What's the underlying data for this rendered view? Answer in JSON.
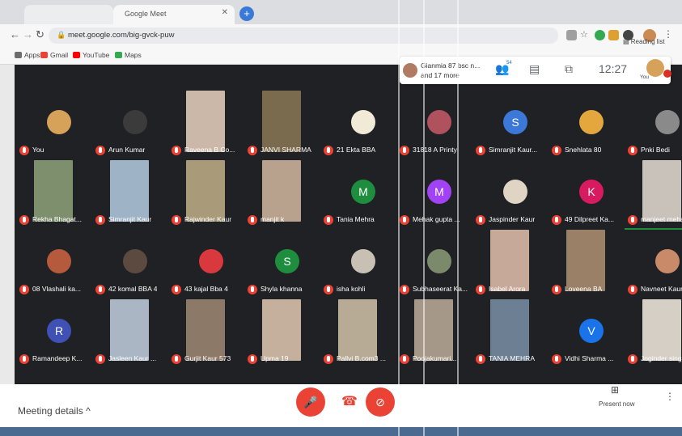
{
  "browser": {
    "tab_title": "Google Meet",
    "url": "meet.google.com/big-gvck-puw",
    "reading_list_label": "Reading list",
    "bookmarks": [
      {
        "label": "Apps",
        "icon": "apps-grid-icon",
        "color": "#6c6c6c"
      },
      {
        "label": "Gmail",
        "icon": "gmail-icon",
        "color": "#ea4335"
      },
      {
        "label": "YouTube",
        "icon": "youtube-icon",
        "color": "#ff0000"
      },
      {
        "label": "Maps",
        "icon": "maps-icon",
        "color": "#34a853"
      }
    ]
  },
  "meet": {
    "pinned": {
      "line1": "Gianmia 87 bsc n...",
      "line2": "and 17 more"
    },
    "participants_count": "54",
    "time": "12:27",
    "self_label": "You",
    "meeting_details_label": "Meeting details",
    "present_now_label": "Present now",
    "participants": [
      {
        "name": "You",
        "kind": "photo",
        "color": "#d6a25a"
      },
      {
        "name": "Arun Kumar",
        "kind": "photo",
        "color": "#3b3b3b"
      },
      {
        "name": "Raveena B Co...",
        "kind": "video",
        "color": "#cbb8a8"
      },
      {
        "name": "JANVI SHARMA",
        "kind": "video",
        "color": "#7a6a4e"
      },
      {
        "name": "21 Ekta BBA",
        "kind": "photo",
        "color": "#f0ead6"
      },
      {
        "name": "31818 A Printy",
        "kind": "photo",
        "color": "#b0515e"
      },
      {
        "name": "Simranjit Kaur...",
        "kind": "letter",
        "letter": "S",
        "color": "#3c78d8"
      },
      {
        "name": "Snehlata 80",
        "kind": "photo",
        "color": "#e3a73d"
      },
      {
        "name": "Pnki Bedi",
        "kind": "photo",
        "color": "#8a8a8a"
      },
      {
        "name": "Rekha Bhagat...",
        "kind": "video",
        "color": "#7d8f6d"
      },
      {
        "name": "Simranjit Kaur",
        "kind": "video",
        "color": "#9fb3c6"
      },
      {
        "name": "Rajwinder Kaur",
        "kind": "video",
        "color": "#a99a7a"
      },
      {
        "name": "manjit k",
        "kind": "video",
        "color": "#b9a28d"
      },
      {
        "name": "Tania Mehra",
        "kind": "letter",
        "letter": "M",
        "color": "#1e8e3e"
      },
      {
        "name": "Mehak gupta ...",
        "kind": "letter",
        "letter": "M",
        "color": "#a142f4"
      },
      {
        "name": "Jaspinder Kaur",
        "kind": "photo",
        "color": "#e0d4c4"
      },
      {
        "name": "49 Dilpreet Ka...",
        "kind": "letter",
        "letter": "K",
        "color": "#d81b60"
      },
      {
        "name": "manjeet mehas",
        "kind": "video",
        "color": "#c8c2bb"
      },
      {
        "name": "08 Vlashali ka...",
        "kind": "photo",
        "color": "#b55a3c"
      },
      {
        "name": "42 komal BBA 4",
        "kind": "photo",
        "color": "#5c4a40"
      },
      {
        "name": "43 kajal Bba 4",
        "kind": "photo",
        "color": "#d9393e"
      },
      {
        "name": "Shyla khanna",
        "kind": "letter",
        "letter": "S",
        "color": "#1e8e3e"
      },
      {
        "name": "isha kohli",
        "kind": "photo",
        "color": "#c9c0b4"
      },
      {
        "name": "Subhaseerat Ka...",
        "kind": "photo",
        "color": "#7a8a6a"
      },
      {
        "name": "Isabel Arora",
        "kind": "video",
        "color": "#c7a99a"
      },
      {
        "name": "Loveena BA",
        "kind": "video",
        "color": "#9a8066"
      },
      {
        "name": "Navneet Kaur ...",
        "kind": "photo",
        "color": "#c98a6a"
      },
      {
        "name": "Ramandeep K...",
        "kind": "letter",
        "letter": "R",
        "color": "#3f51b5"
      },
      {
        "name": "Jasleen Kaur ...",
        "kind": "video",
        "color": "#aab6c4"
      },
      {
        "name": "Gurjit Kaur 573",
        "kind": "video",
        "color": "#8c7968"
      },
      {
        "name": "Upma 19",
        "kind": "video",
        "color": "#c4b09c"
      },
      {
        "name": "Pallvi B.com3 ...",
        "kind": "video",
        "color": "#b8ab96"
      },
      {
        "name": "Poojakumari...",
        "kind": "video",
        "color": "#a59888"
      },
      {
        "name": "TANIA MEHRA",
        "kind": "video",
        "color": "#6d7f93"
      },
      {
        "name": "Vidhi Sharma ...",
        "kind": "letter",
        "letter": "V",
        "color": "#1a73e8"
      },
      {
        "name": "Joginder singh",
        "kind": "video",
        "color": "#d5cfc6"
      }
    ]
  }
}
